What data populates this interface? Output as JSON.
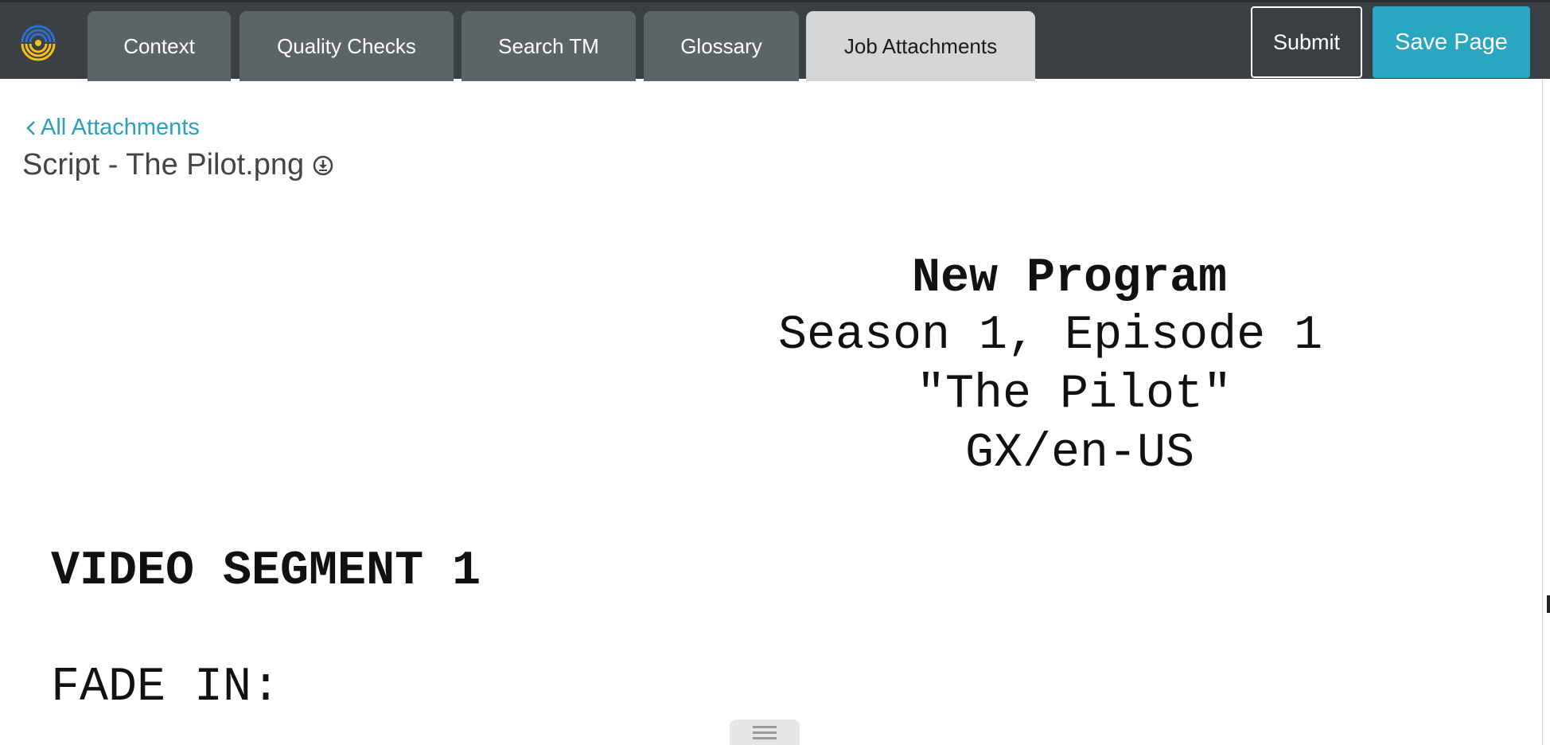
{
  "topbar": {
    "tabs": [
      {
        "label": "Context"
      },
      {
        "label": "Quality Checks"
      },
      {
        "label": "Search TM"
      },
      {
        "label": "Glossary"
      },
      {
        "label": "Job Attachments",
        "active": true
      }
    ],
    "submit_label": "Submit",
    "save_label": "Save Page",
    "colors": {
      "bar": "#3b4045",
      "tab": "#5b6568",
      "active_tab": "#d3d5d6",
      "accent": "#2aa6c0"
    }
  },
  "attachment": {
    "back_label": "All Attachments",
    "file_name": "Script - The Pilot.png",
    "icons": [
      "chevron-left-icon",
      "download-icon"
    ]
  },
  "script": {
    "title": "New Program",
    "season_line": "Season 1, Episode 1",
    "episode_line": "\"The Pilot\"",
    "locale_line": "GX/en-US",
    "segment_heading": "VIDEO SEGMENT 1",
    "transition": "FADE IN:"
  }
}
